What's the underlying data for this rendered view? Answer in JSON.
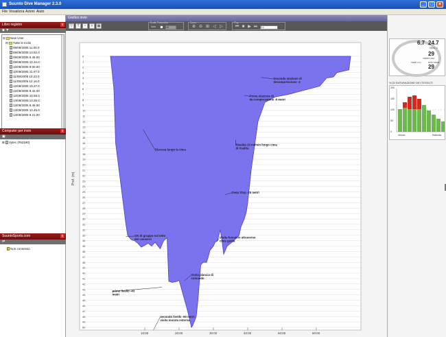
{
  "window": {
    "title": "Suunto Dive Manager 2.3.0",
    "controls": [
      "minimize",
      "maximize",
      "close"
    ]
  },
  "menu": {
    "items": [
      "File",
      "Visualizza",
      "Azioni",
      "Aiuto"
    ]
  },
  "left_panel": {
    "log_header": "Libro registro",
    "log_tree": {
      "user": "New User",
      "folder": "Tutte le inclsi",
      "entries": [
        "08/09/2005 11.00.0",
        "08/09/2005 13.52.0",
        "09/09/2005 8.45.00",
        "09/09/2005 10.34.0",
        "10/09/2005 9.00.00",
        "10/09/2005 11.07.0",
        "11/09/2005 10.22.0",
        "11/09/2005 12.16.0",
        "12/09/2005 15.27.0",
        "12/09/2005 8.42.00",
        "12/09/2005 10.59.0",
        "13/09/2005 13.35.0",
        "13/09/2005 8.45.00",
        "13/09/2005 10.45.0",
        "14/09/2005 9.21.00"
      ]
    },
    "computer_header": "Computer per invio",
    "computer_device": "Vytec (#52190)",
    "sports_header": "SuuntoSports.com",
    "sports_status": "Non connesso"
  },
  "chart_panel": {
    "header": "Grafico invio",
    "toolbar": {
      "group_labels": [
        "Scala Profondita",
        "Zoom",
        "Play"
      ],
      "scale_label": "Auto",
      "scale_value": "45",
      "speed_value": "5 x"
    }
  },
  "right_panel": {
    "gauge": {
      "values": [
        "6.7",
        "24.7",
        "29",
        "29"
      ],
      "labels": [
        "TEMPO ASC",
        "TEMP (°C)",
        "DUR. IMMR",
        "PROF. m"
      ]
    },
    "tissue_title": "% DI SATURAZIONE DEI TESSUTI",
    "tissue_chart": {
      "y_ticks": [
        "200",
        "150",
        "100",
        "50",
        "0"
      ],
      "x_labels": [
        "Veloce",
        "Rallenta"
      ],
      "colors": {
        "green": "#6bb84e",
        "red": "#d22a1e"
      }
    }
  },
  "chart_data": {
    "type": "area",
    "title": "",
    "xlabel": "",
    "ylabel": "Prof. (m)",
    "y_axis": {
      "min": 0,
      "max": 45,
      "reversed": true,
      "ticks": [
        0,
        1,
        2,
        3,
        4,
        5,
        6,
        7,
        8,
        9,
        10,
        11,
        12,
        13,
        14,
        15,
        16,
        17,
        18,
        19,
        20,
        21,
        22,
        23,
        24,
        25,
        26,
        27,
        28,
        29,
        30,
        31,
        32,
        33,
        34,
        35,
        36,
        37,
        38,
        39,
        40,
        41,
        42,
        43,
        44,
        45,
        46,
        47,
        48,
        49,
        50
      ]
    },
    "x_axis": {
      "ticks": [
        "10:00",
        "20:00",
        "30:00",
        "40:00",
        "50:00",
        "60:00"
      ]
    },
    "fill_color": "#7b72ee",
    "series": [
      {
        "time_min": [
          0.0,
          1.0,
          1.5,
          3.5,
          4.5,
          5.0,
          5.6,
          6.0,
          7.0,
          8.0,
          9.0,
          11.0,
          12.0,
          13.0,
          14.5,
          15.5,
          16.5,
          17.0,
          18.0,
          19.5,
          20.0,
          22.5,
          23.0,
          23.6,
          24.0,
          25.0,
          25.5,
          26.3,
          27.0,
          28.0,
          28.5,
          29.0,
          30.0,
          30.5,
          31.2,
          32.0,
          32.5,
          33.0,
          34.0,
          36.0,
          37.5,
          38.0,
          39.0,
          39.6,
          40.0,
          40.5,
          41.0,
          42.0,
          43.0,
          45.0,
          48.0,
          52.0,
          55.0,
          58.0,
          61.0,
          63.0,
          65.0,
          66.0,
          69.5,
          70.0
        ],
        "depth_m": [
          0.0,
          6.0,
          16.0,
          26.0,
          31.0,
          33.0,
          33.5,
          33.8,
          34.0,
          34.5,
          35.2,
          34.5,
          35.0,
          34.3,
          35.5,
          34.0,
          33.5,
          41.5,
          41.7,
          41.5,
          41.3,
          47.0,
          48.3,
          50.0,
          49.6,
          48.0,
          45.0,
          38.5,
          38.0,
          38.0,
          37.0,
          35.8,
          35.0,
          34.3,
          34.0,
          32.0,
          34.0,
          36.5,
          35.0,
          34.0,
          33.0,
          31.5,
          30.0,
          28.7,
          27.0,
          24.0,
          21.0,
          16.5,
          12.0,
          8.5,
          7.5,
          7.0,
          6.5,
          6.0,
          5.5,
          4.0,
          3.8,
          3.0,
          2.5,
          0.0
        ]
      }
    ],
    "annotations": [
      "Discesa lungo la cima",
      "OK di gruppo sul tetto del casseroi",
      "primo livello -43 metri",
      "secondo livello -50 metri visita murata esterna",
      "Visita plancia di comando",
      "Visita fumaiolo attraverso cima guida",
      "Deep Stop -25 metri",
      "Risalita 10 mt/min lungo cima di risalita",
      "Prima stazione di de-compressione -6 metri",
      "Seconda stazione di decompressione -3"
    ]
  }
}
